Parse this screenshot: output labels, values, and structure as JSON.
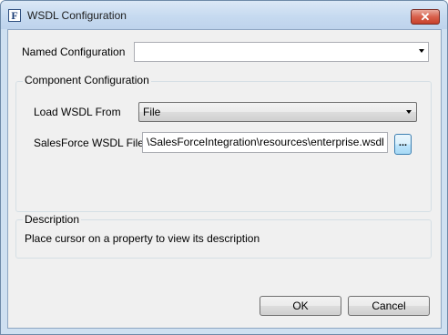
{
  "window": {
    "title": "WSDL Configuration",
    "app_icon_glyph": "F",
    "close_glyph": "✕"
  },
  "named_configuration": {
    "label": "Named Configuration",
    "value": ""
  },
  "component_group": {
    "title": "Component Configuration",
    "load_wsdl_label": "Load WSDL From",
    "load_wsdl_value": "File",
    "wsdl_file_label": "SalesForce WSDL File",
    "wsdl_file_value": "\\SalesForceIntegration\\resources\\enterprise.wsdl",
    "browse_label": "..."
  },
  "description": {
    "title": "Description",
    "text": "Place cursor on a property to view its description"
  },
  "buttons": {
    "ok": "OK",
    "cancel": "Cancel"
  }
}
